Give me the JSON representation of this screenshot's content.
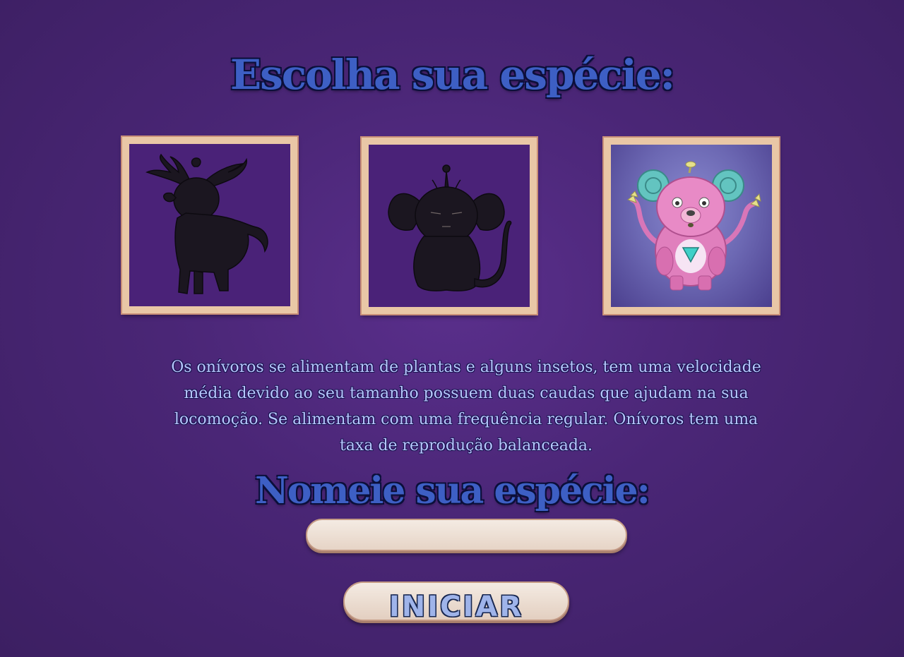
{
  "screen": {
    "choose_title": "Escolha sua espécie:",
    "name_title": "Nomeie sua espécie:",
    "description": "Os onívoros se alimentam de plantas e alguns insetos, tem uma velocidade média devido ao seu tamanho possuem duas caudas que ajudam na sua locomoção. Se alimentam com uma frequência regular. Onívoros tem uma taxa de reprodução balanceada.",
    "name_input_value": "",
    "start_label": "INICIAR"
  },
  "species": [
    {
      "icon": "horned-beast-silhouette-icon",
      "selected": false
    },
    {
      "icon": "big-eared-creature-silhouette-icon",
      "selected": false
    },
    {
      "icon": "pink-omnivore-creature-icon",
      "selected": true
    }
  ],
  "colors": {
    "background": "#4a2676",
    "title": "#3d5fc4",
    "description_text": "#b8c8ff",
    "frame_wood": "#e9c7a6",
    "selected_card_bg": "#6c68b3"
  }
}
